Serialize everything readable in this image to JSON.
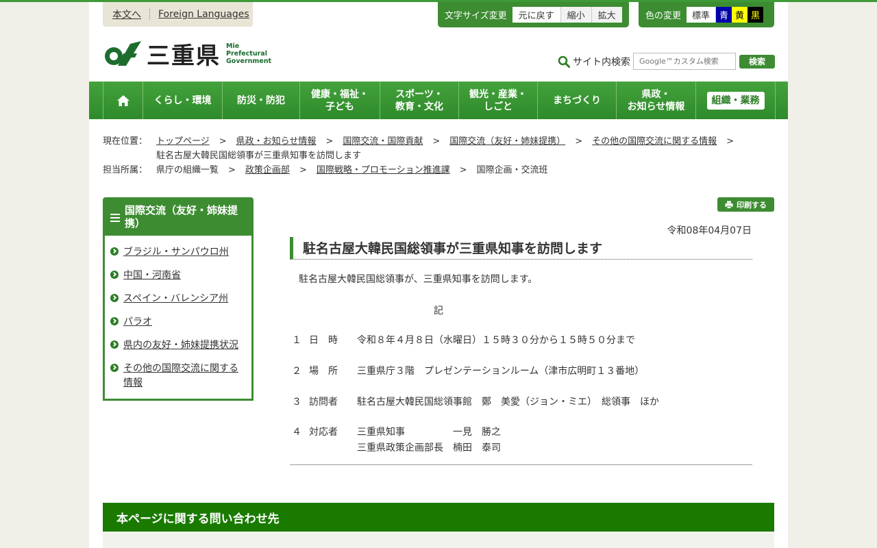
{
  "skip": {
    "main_link": "本文へ",
    "lang_link": "Foreign Languages"
  },
  "font_tool": {
    "label": "文字サイズ変更",
    "reset": "元に戻す",
    "smaller": "縮小",
    "larger": "拡大"
  },
  "color_tool": {
    "label": "色の変更",
    "options": [
      {
        "label": "標準",
        "bg": "#ffffff",
        "fg": "#333333"
      },
      {
        "label": "青",
        "bg": "#0000aa",
        "fg": "#ffffff"
      },
      {
        "label": "黄",
        "bg": "#ffff00",
        "fg": "#000000"
      },
      {
        "label": "黒",
        "bg": "#000000",
        "fg": "#ffff00"
      }
    ]
  },
  "logo": {
    "name": "三重県",
    "en_line1": "Mie",
    "en_line2": "Prefectural",
    "en_line3": "Government"
  },
  "search": {
    "label": "サイト内検索",
    "placeholder": "Google™カスタム検索",
    "button": "検索"
  },
  "nav": {
    "home_icon": "home-icon",
    "items": [
      {
        "line1": "くらし・環境",
        "line2": ""
      },
      {
        "line1": "防災・防犯",
        "line2": ""
      },
      {
        "line1": "健康・福祉・",
        "line2": "子ども"
      },
      {
        "line1": "スポーツ・",
        "line2": "教育・文化"
      },
      {
        "line1": "観光・産業・",
        "line2": "しごと"
      },
      {
        "line1": "まちづくり",
        "line2": ""
      },
      {
        "line1": "県政・",
        "line2": "お知らせ情報"
      },
      {
        "line1": "組織・業務",
        "line2": ""
      }
    ]
  },
  "breadcrumb": {
    "label": "現在位置：",
    "links": [
      "トップページ",
      "県政・お知らせ情報",
      "国際交流・国際貢献",
      "国際交流（友好・姉妹提携）",
      "その他の国際交流に関する情報"
    ],
    "current": "駐名古屋大韓民国総領事が三重県知事を訪問します",
    "separator": ">"
  },
  "department": {
    "label": "担当所属：",
    "first": "県庁の組織一覧",
    "links": [
      "政策企画部",
      "国際戦略・プロモーション推進課"
    ],
    "last": "国際企画・交流班"
  },
  "sidebar": {
    "title": "国際交流（友好・姉妹提携）",
    "items": [
      "ブラジル・サンパウロ州",
      "中国・河南省",
      "スペイン・バレンシア州",
      "パラオ",
      "県内の友好・姉妹提携状況",
      "その他の国際交流に関する情報"
    ]
  },
  "print_button": "印刷する",
  "article": {
    "date": "令和08年04月07日",
    "title": "駐名古屋大韓民国総領事が三重県知事を訪問します",
    "lead": "駐名古屋大韓民国総領事が、三重県知事を訪問します。",
    "ki": "記",
    "details": [
      {
        "num": "１",
        "key": "日　時",
        "value": "令和８年４月８日（水曜日）１５時３０分から１５時５０分まで"
      },
      {
        "num": "２",
        "key": "場　所",
        "value": "三重県庁３階　プレゼンテーションルーム（津市広明町１３番地）"
      },
      {
        "num": "３",
        "key": "訪問者",
        "value": "駐名古屋大韓民国総領事館　鄭　美愛（ジョン・ミエ）　総領事　ほか"
      },
      {
        "num": "４",
        "key": "対応者",
        "rows": [
          {
            "role": "三重県知事",
            "name": "一見　勝之"
          },
          {
            "role": "三重県政策企画部長",
            "name": "楠田　泰司"
          }
        ]
      }
    ]
  },
  "contact": {
    "title": "本ページに関する問い合わせ先"
  }
}
